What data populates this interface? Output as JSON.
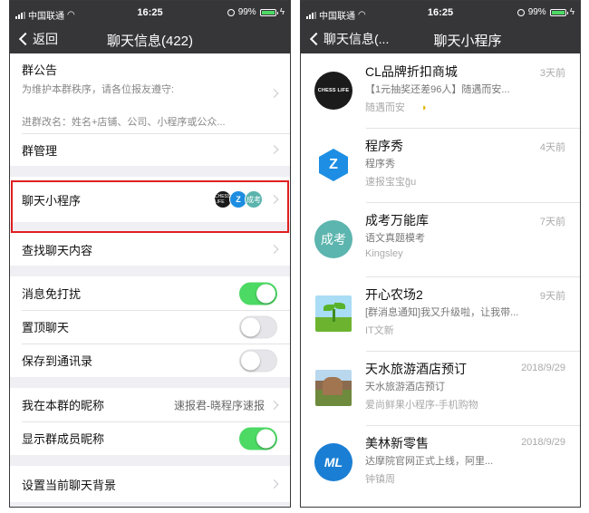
{
  "left": {
    "status": {
      "carrier": "中国联通",
      "time": "16:25",
      "battery": "99%"
    },
    "nav": {
      "back_label": "返回",
      "title": "聊天信息(422)"
    },
    "notice": {
      "title": "群公告",
      "line1": "为维护本群秩序，请各位报友遵守:",
      "line2": "进群改名：姓名+店铺、公司、小程序或公众..."
    },
    "group_manage": "群管理",
    "mini_program": {
      "label": "聊天小程序",
      "icons": [
        "CHESS LIFE",
        "Z",
        "成考"
      ]
    },
    "search_chat": "查找聊天内容",
    "mute": {
      "label": "消息免打扰",
      "on": true
    },
    "pin": {
      "label": "置顶聊天",
      "on": false
    },
    "save_contacts": {
      "label": "保存到通讯录",
      "on": false
    },
    "my_nickname": {
      "label": "我在本群的昵称",
      "value": "速报君-晓程序速报"
    },
    "show_nicknames": {
      "label": "显示群成员昵称",
      "on": true
    },
    "background": "设置当前聊天背景"
  },
  "right": {
    "status": {
      "carrier": "中国联通",
      "time": "16:25",
      "battery": "99%"
    },
    "nav": {
      "back_label": "聊天信息(...",
      "title": "聊天小程序"
    },
    "items": [
      {
        "name": "CL品牌折扣商城",
        "desc": "【1元抽奖还差96人】随遇而安...",
        "meta": "随遇而安",
        "time": "3天前",
        "icon": "chess-life-icon",
        "icon_text": "CHESS LIFE"
      },
      {
        "name": "程序秀",
        "desc": "程序秀",
        "meta": "速报宝宝ğ̈u",
        "time": "4天前",
        "icon": "chengxuxiu-icon",
        "icon_text": "Z"
      },
      {
        "name": "成考万能库",
        "desc": "语文真题模考",
        "meta": "Kingsley",
        "time": "7天前",
        "icon": "chengkao-icon",
        "icon_text": "成考"
      },
      {
        "name": "开心农场2",
        "desc": "[群消息通知]我又升级啦，让我带...",
        "meta": "IT文新",
        "time": "9天前",
        "icon": "farm-sprout-icon",
        "icon_text": ""
      },
      {
        "name": "天水旅游酒店预订",
        "desc": "天水旅游酒店预订",
        "meta": "爱尚鲜果小程序-手机购物",
        "time": "2018/9/29",
        "icon": "hotel-landscape-icon",
        "icon_text": ""
      },
      {
        "name": "美林新零售",
        "desc": "达摩院官网正式上线，阿里...",
        "meta": "钟镇周",
        "time": "2018/9/29",
        "icon": "meilin-icon",
        "icon_text": "ML"
      }
    ]
  },
  "colors": {
    "navbar": "#363639",
    "toggle_on": "#4cd964",
    "highlight": "#e02020",
    "background": "#efeff4"
  }
}
